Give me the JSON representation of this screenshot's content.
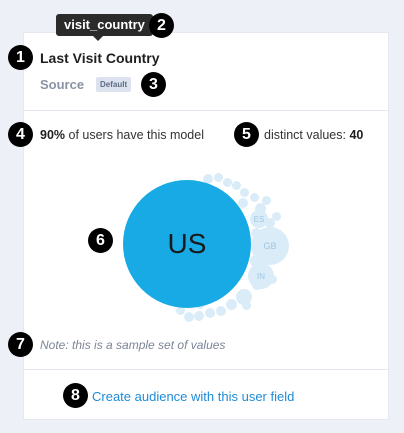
{
  "tooltip": {
    "text": "visit_country"
  },
  "field": {
    "title": "Last Visit Country"
  },
  "source": {
    "label": "Source",
    "badge": "Default"
  },
  "stats": {
    "percent": "90%",
    "percent_suffix": " of users have this model",
    "distinct_label": "distinct values: ",
    "distinct_count": "40"
  },
  "bubbles": {
    "main": "US",
    "second": "GB",
    "third": "IN"
  },
  "note": "Note: this is a sample set of values",
  "cta": "Create audience with this user field",
  "markers": [
    "1",
    "2",
    "3",
    "4",
    "5",
    "6",
    "7",
    "8"
  ]
}
